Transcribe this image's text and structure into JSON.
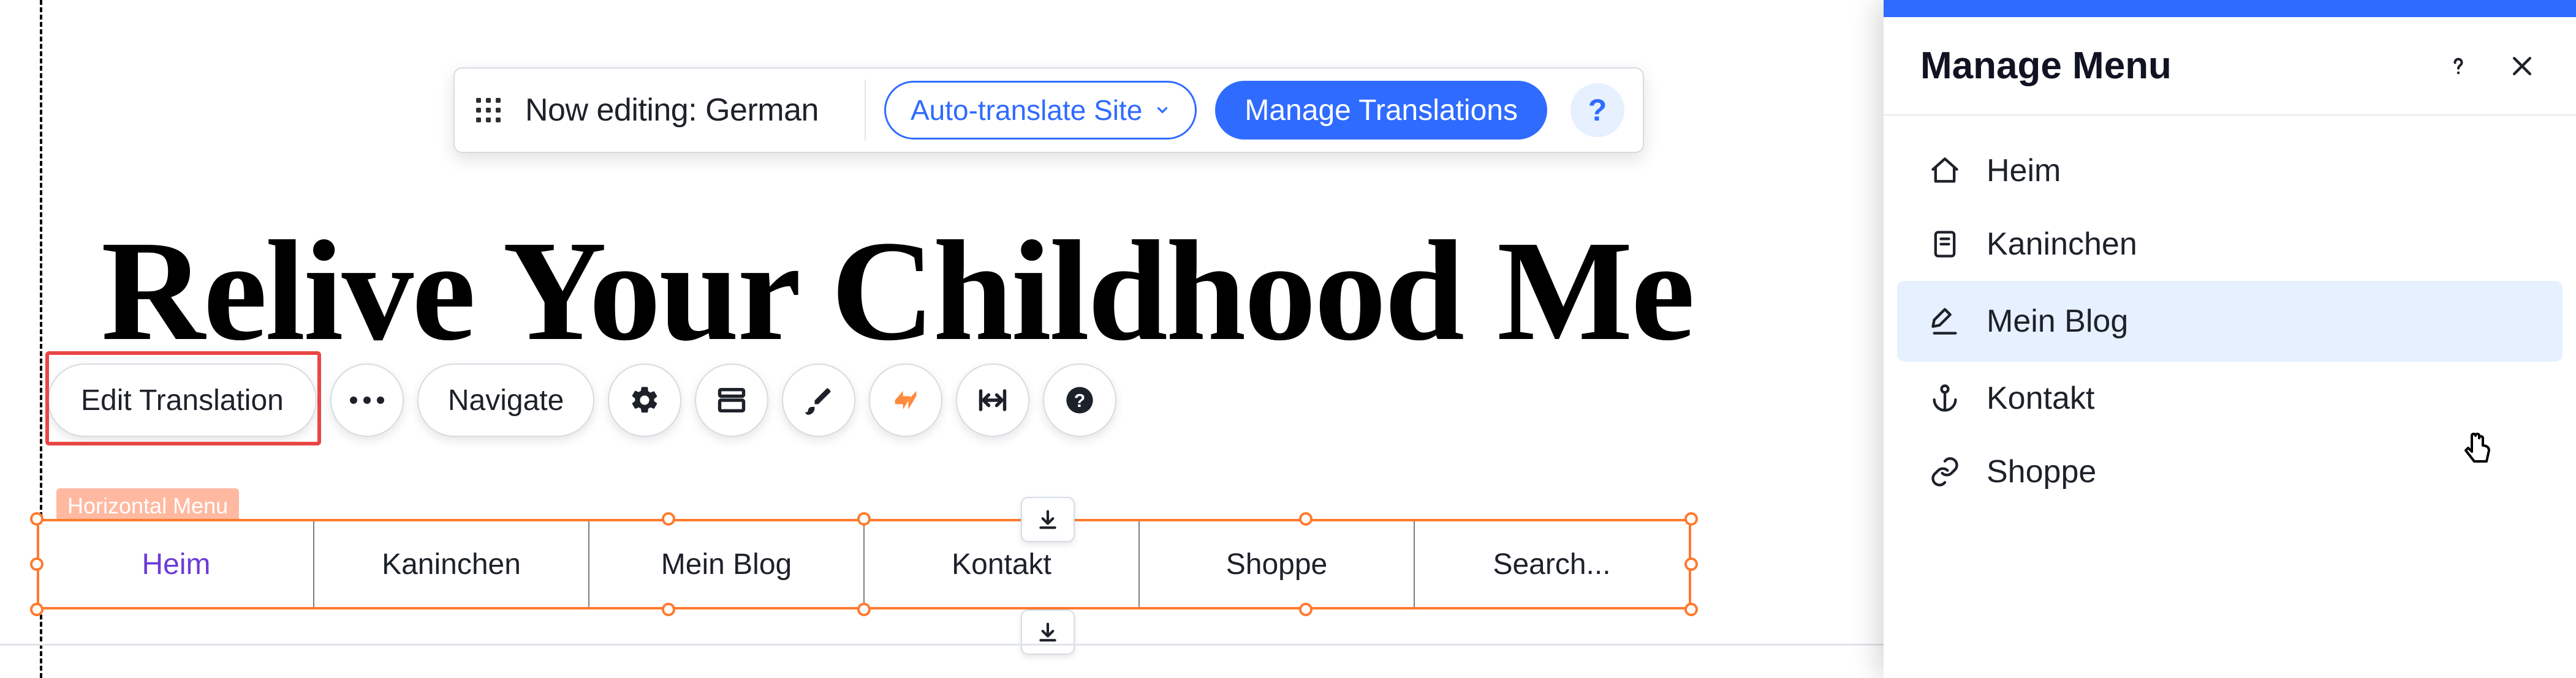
{
  "editor": {
    "now_editing_label": "Now editing: German",
    "auto_translate_label": "Auto-translate Site",
    "manage_translations_label": "Manage Translations"
  },
  "headline": "Relive Your Childhood Me",
  "context_toolbar": {
    "edit_translation_label": "Edit Translation",
    "navigate_label": "Navigate"
  },
  "horizontal_menu": {
    "label": "Horizontal Menu",
    "items": [
      {
        "label": "Heim",
        "active": true
      },
      {
        "label": "Kaninchen",
        "active": false
      },
      {
        "label": "Mein Blog",
        "active": false
      },
      {
        "label": "Kontakt",
        "active": false
      },
      {
        "label": "Shoppe",
        "active": false
      },
      {
        "label": "Search...",
        "active": false
      }
    ]
  },
  "panel": {
    "title": "Manage Menu",
    "items": [
      {
        "icon": "home-icon",
        "label": "Heim"
      },
      {
        "icon": "page-icon",
        "label": "Kaninchen"
      },
      {
        "icon": "pen-icon",
        "label": "Mein Blog",
        "selected": true
      },
      {
        "icon": "anchor-icon",
        "label": "Kontakt"
      },
      {
        "icon": "link-icon",
        "label": "Shoppe"
      }
    ]
  },
  "colors": {
    "accent": "#2f6bff",
    "selection": "#ff7a2f",
    "highlight": "#e94646"
  }
}
